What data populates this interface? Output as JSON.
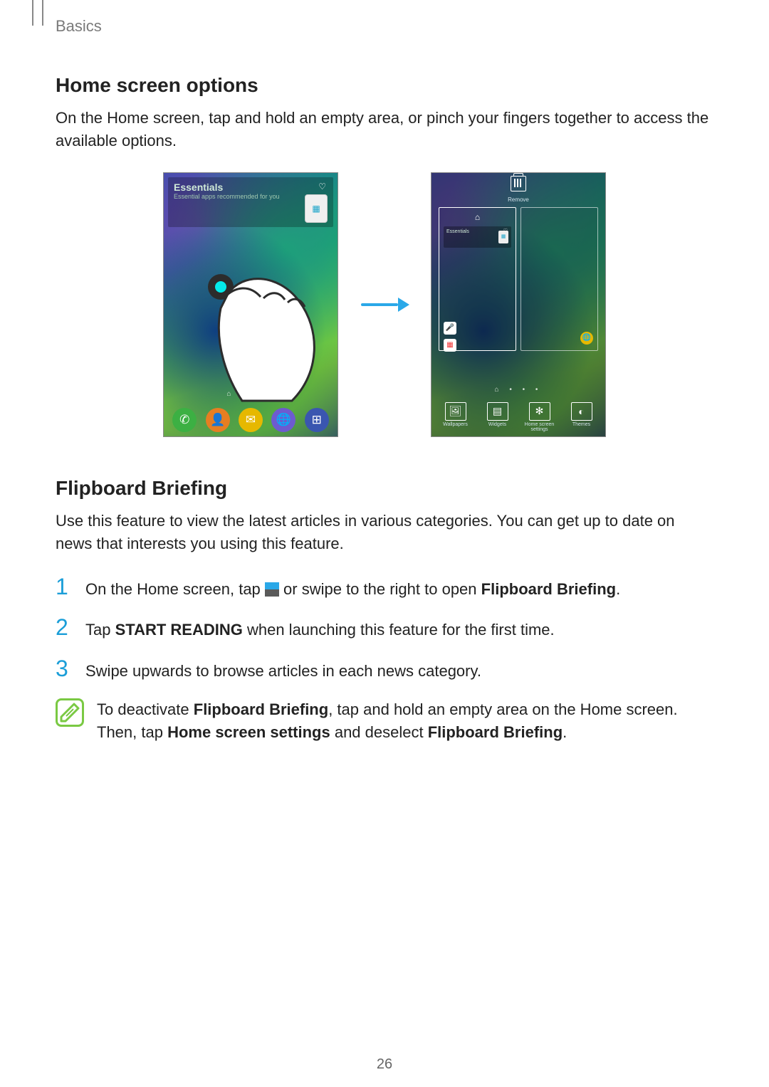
{
  "header": {
    "section": "Basics"
  },
  "page_number": "26",
  "section1": {
    "heading": "Home screen options",
    "paragraph": "On the Home screen, tap and hold an empty area, or pinch your fingers together to access the available options."
  },
  "figure": {
    "left_phone": {
      "widget_title": "Essentials",
      "widget_subtitle": "Essential apps recommended for you",
      "dock": {
        "phone": "Phone",
        "contacts": "Contacts",
        "messages": "Messages",
        "internet": "Internet",
        "apps": "Apps"
      }
    },
    "right_phone": {
      "remove": "Remove",
      "panel_widget_title": "Essentials",
      "options": {
        "wallpapers": "Wallpapers",
        "widgets": "Widgets",
        "home_settings": "Home screen settings",
        "themes": "Themes"
      }
    }
  },
  "section2": {
    "heading": "Flipboard Briefing",
    "paragraph": "Use this feature to view the latest articles in various categories. You can get up to date on news that interests you using this feature.",
    "step1": {
      "pre": "On the Home screen, tap ",
      "post": " or swipe to the right to open ",
      "bold": "Flipboard Briefing",
      "tail": "."
    },
    "step2": {
      "pre": "Tap ",
      "bold": "START READING",
      "post": " when launching this feature for the first time."
    },
    "step3": {
      "text": "Swipe upwards to browse articles in each news category."
    },
    "note": {
      "t1": "To deactivate ",
      "b1": "Flipboard Briefing",
      "t2": ", tap and hold an empty area on the Home screen. Then, tap ",
      "b2": "Home screen settings",
      "t3": " and deselect ",
      "b3": "Flipboard Briefing",
      "t4": "."
    }
  }
}
